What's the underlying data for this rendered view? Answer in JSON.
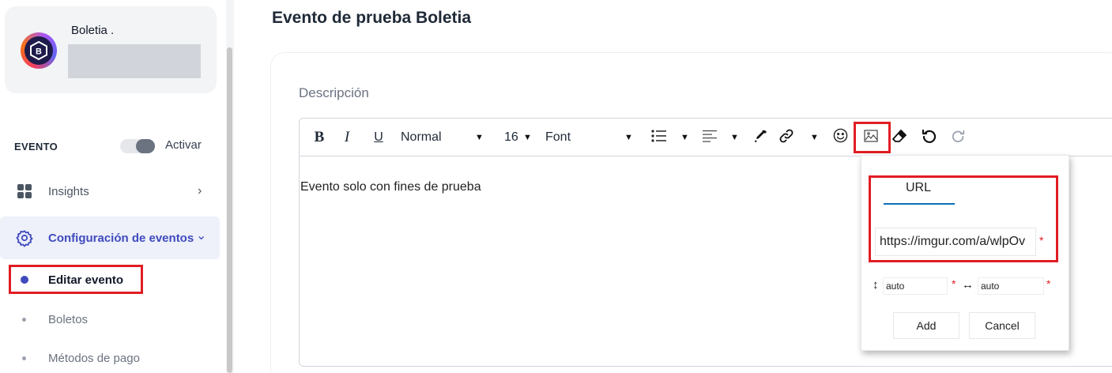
{
  "org": {
    "name": "Boletia .",
    "logo_letter": "B"
  },
  "sidebar": {
    "section_label": "EVENTO",
    "toggle_label": "Activar",
    "items": [
      {
        "label": "Insights",
        "icon": "grid-icon",
        "chevron": "›"
      },
      {
        "label": "Configuración de eventos",
        "icon": "gear-icon",
        "chevron": "⌄"
      }
    ],
    "subitems": [
      {
        "label": "Editar evento",
        "active": true
      },
      {
        "label": "Boletos"
      },
      {
        "label": "Métodos de pago"
      }
    ]
  },
  "main": {
    "title": "Evento de prueba Boletia",
    "field_label": "Descripción"
  },
  "editor": {
    "toolbar": {
      "bold": "B",
      "italic": "I",
      "underline": "U",
      "heading_select": "Normal",
      "size_select": "16",
      "font_select": "Font"
    },
    "content": "Evento solo con fines de prueba"
  },
  "image_popover": {
    "tab_label": "URL",
    "url_value": "https://imgur.com/a/wlpOv",
    "required_mark": "*",
    "height_value": "auto",
    "width_value": "auto",
    "add_label": "Add",
    "cancel_label": "Cancel"
  },
  "colors": {
    "accent": "#3f4bbd",
    "highlight_box": "#e11d24",
    "tab_underline": "#0b6fb8"
  }
}
